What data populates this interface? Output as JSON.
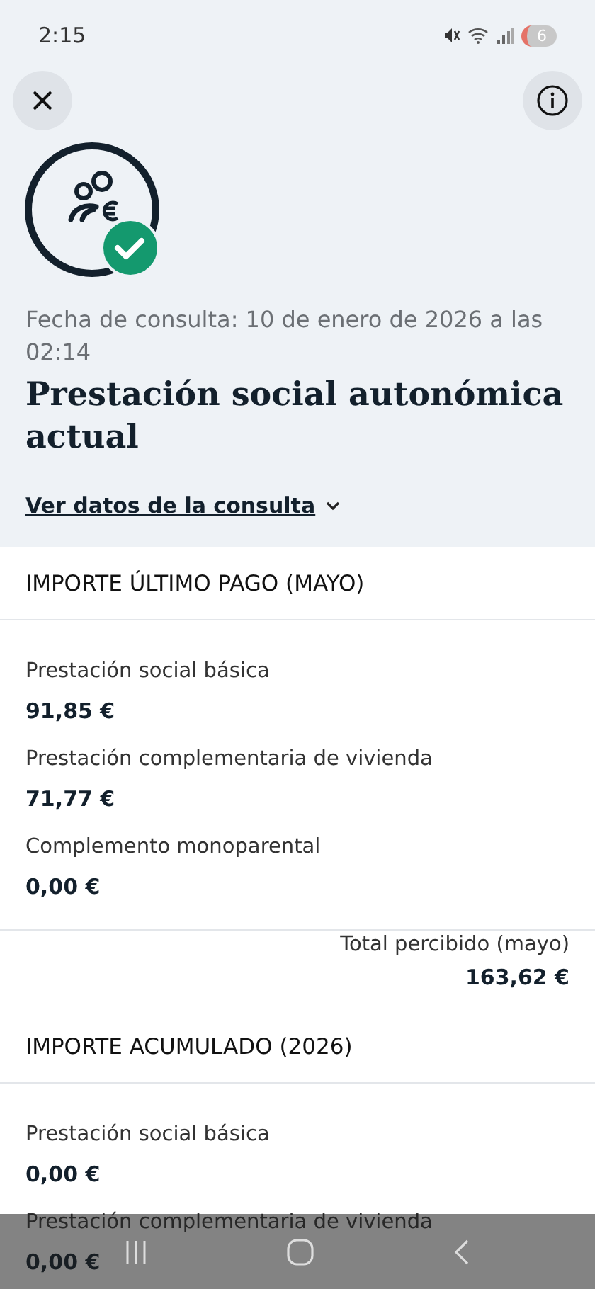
{
  "status_bar": {
    "time": "2:15",
    "notification_count": "6"
  },
  "header": {
    "date_text": "Fecha de consulta: 10 de enero de 2026 a las 02:14",
    "title": "Prestación social autonómica actual",
    "link": "Ver datos de la consulta"
  },
  "sections": [
    {
      "heading": "IMPORTE ÚLTIMO PAGO (MAYO)",
      "items": [
        {
          "label": "Prestación social básica",
          "value": "91,85 €"
        },
        {
          "label": "Prestación complementaria de vivienda",
          "value": "71,77 €"
        },
        {
          "label": "Complemento monoparental",
          "value": "0,00 €"
        }
      ],
      "total": {
        "label": "Total percibido (mayo)",
        "value": "163,62 €"
      }
    },
    {
      "heading": "IMPORTE ACUMULADO (2026)",
      "items": [
        {
          "label": "Prestación social básica",
          "value": "0,00 €"
        },
        {
          "label": "Prestación complementaria de vivienda",
          "value": "0,00 €"
        }
      ]
    }
  ]
}
